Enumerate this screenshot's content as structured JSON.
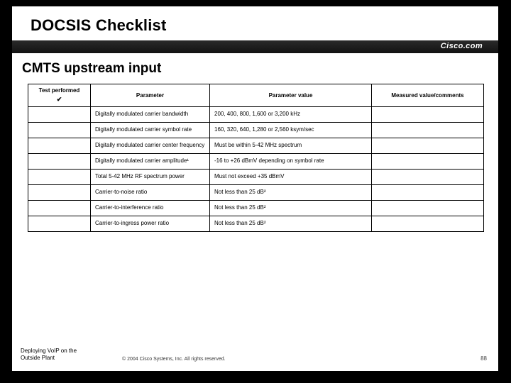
{
  "title": "DOCSIS Checklist",
  "brand": "Cisco.com",
  "subtitle": "CMTS upstream input",
  "headers": {
    "h1": "Test performed",
    "h1_mark": "✔",
    "h2": "Parameter",
    "h3": "Parameter value",
    "h4": "Measured value/comments"
  },
  "rows": [
    {
      "param": "Digitally modulated carrier bandwidth",
      "value": "200, 400, 800, 1,600 or 3,200 kHz"
    },
    {
      "param": "Digitally modulated carrier symbol rate",
      "value": "160, 320, 640, 1,280 or 2,560 ksym/sec"
    },
    {
      "param": "Digitally modulated carrier center frequency",
      "value": "Must be within 5-42 MHz spectrum"
    },
    {
      "param": "Digitally modulated carrier amplitude¹",
      "value": "-16 to +26 dBmV depending on symbol rate"
    },
    {
      "param": "Total 5-42 MHz RF spectrum power",
      "value": "Must not exceed +35 dBmV"
    },
    {
      "param": "Carrier-to-noise ratio",
      "value": "Not less than 25 dB²"
    },
    {
      "param": "Carrier-to-interference ratio",
      "value": "Not less than 25 dB²"
    },
    {
      "param": "Carrier-to-ingress power ratio",
      "value": "Not less than 25 dB²"
    }
  ],
  "footer": {
    "left_line1": "Deploying VoIP on the",
    "left_line2": "Outside Plant",
    "copyright": "© 2004 Cisco Systems, Inc. All rights reserved.",
    "page": "88"
  }
}
